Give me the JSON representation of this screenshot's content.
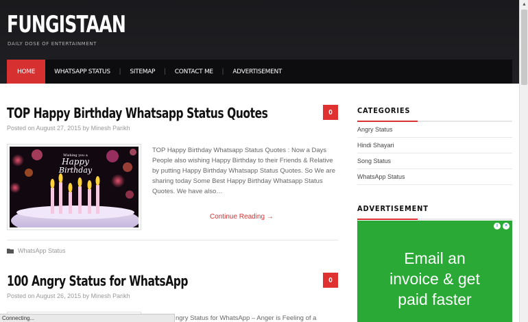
{
  "site": {
    "title": "FUNGISTAAN",
    "tagline": "DAILY DOSE OF ENTERTAINMENT"
  },
  "nav": {
    "items": [
      {
        "label": "HOME",
        "active": true
      },
      {
        "label": "WHATSAPP STATUS",
        "active": false
      },
      {
        "label": "SITEMAP",
        "active": false
      },
      {
        "label": "CONTACT ME",
        "active": false
      },
      {
        "label": "ADVERTISEMENT",
        "active": false
      }
    ],
    "separator": "|"
  },
  "posts": [
    {
      "title": "TOP Happy Birthday Whatsapp Status Quotes",
      "comments": "0",
      "meta": "Posted on August 27, 2015 by Minesh Parikh",
      "thumbnail": {
        "line1": "Wishing you a",
        "line2": "Happy",
        "line3": "Birthday"
      },
      "excerpt": "TOP Happy Birthday Whatsapp Status Quotes : Now a Days People also wishing Happy Birthday to their Friends & Relative by putting Happy Birthday Whatsapp Status Quotes. So We are sharing today Some Best Happy Birthday Whatsapp Status Quotes.  We have also…",
      "read_more": "Continue Reading →",
      "category": "WhatsApp Status"
    },
    {
      "title": "100 Angry Status for WhatsApp",
      "comments": "0",
      "meta": "Posted on August 26, 2015 by Minesh Parikh",
      "excerpt": "ngry Status for WhatsApp – Anger is Feeling of a"
    }
  ],
  "sidebar": {
    "categories_title": "CATEGORIES",
    "categories": [
      "Angry Status",
      "Hindi Shayari",
      "Song Status",
      "WhatsApp Status"
    ],
    "ad_title": "ADVERTISEMENT",
    "ad_text": [
      "Email an",
      "invoice & get",
      "paid faster"
    ]
  },
  "status_bar": "Connecting...",
  "colors": {
    "accent": "#d63031",
    "header_bg": "#1c1c1f",
    "ad_bg": "#2aa936"
  }
}
